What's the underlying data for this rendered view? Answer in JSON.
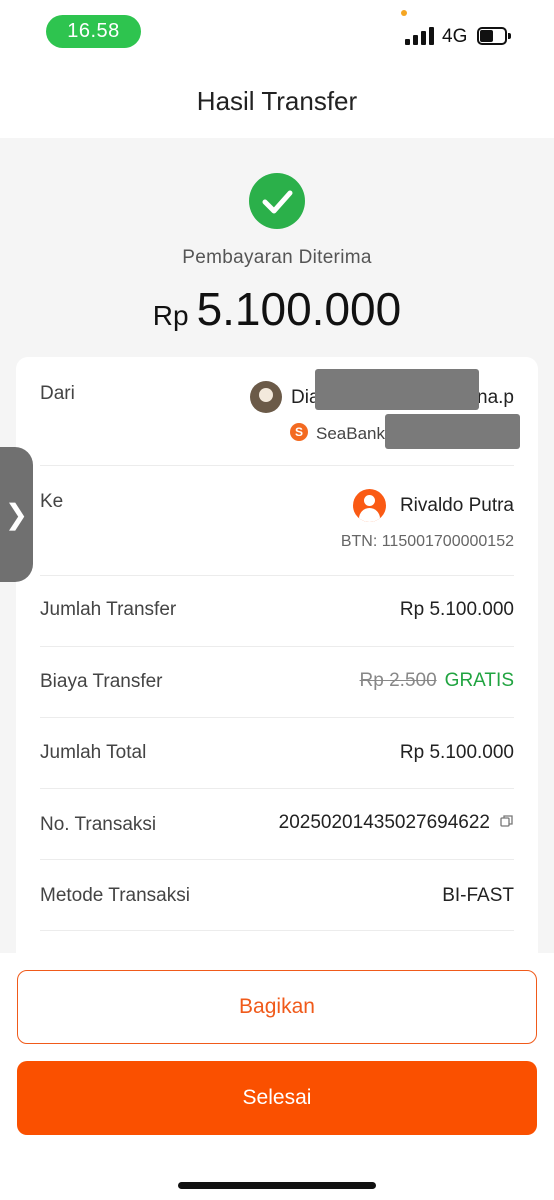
{
  "status_bar": {
    "time": "16.58",
    "network": "4G"
  },
  "header": {
    "title": "Hasil Transfer"
  },
  "result": {
    "status": "Pembayaran Diterima",
    "currency": "Rp",
    "amount": "5.100.000"
  },
  "details": {
    "from": {
      "label": "Dari",
      "name_start": "Dia",
      "name_end": "na.p",
      "bank": "SeaBank"
    },
    "to": {
      "label": "Ke",
      "name": "Rivaldo Putra",
      "account": "BTN: 115001700000152"
    },
    "transfer_amount": {
      "label": "Jumlah Transfer",
      "value": "Rp 5.100.000"
    },
    "fee": {
      "label": "Biaya Transfer",
      "original": "Rp 2.500",
      "value": "GRATIS"
    },
    "total": {
      "label": "Jumlah Total",
      "value": "Rp 5.100.000"
    },
    "transaction_no": {
      "label": "No. Transaksi",
      "value": "20250201435027694622"
    },
    "method": {
      "label": "Metode Transaksi",
      "value": "BI-FAST"
    }
  },
  "side_handle": {
    "glyph": "❯"
  },
  "actions": {
    "share": "Bagikan",
    "done": "Selesai"
  },
  "colors": {
    "primary": "#fa5000",
    "success": "#2bb04a",
    "gratis": "#21a441"
  },
  "icons": [
    "check-icon",
    "seabank-logo",
    "person-icon",
    "copy-icon",
    "chevron-right-icon"
  ]
}
